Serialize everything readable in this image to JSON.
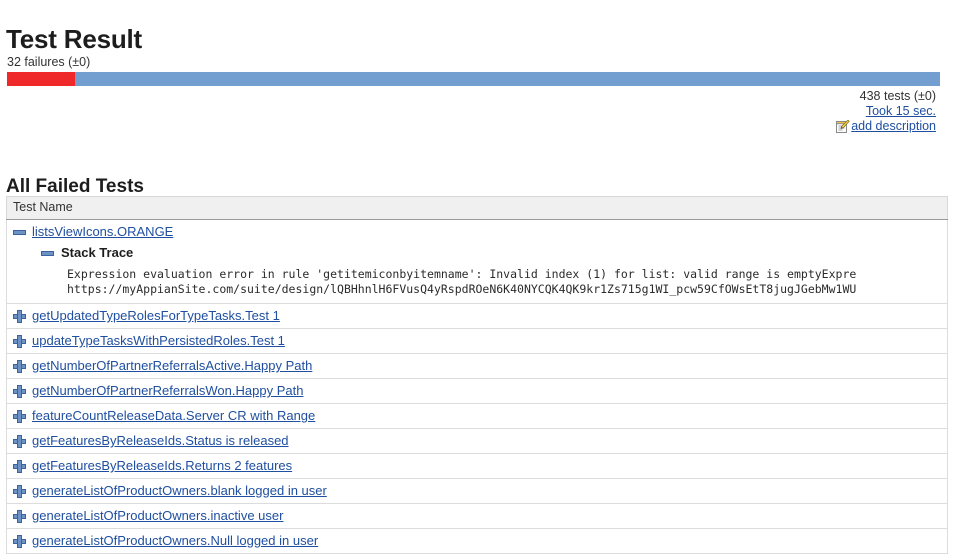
{
  "page": {
    "title": "Test Result",
    "section_title": "All Failed Tests"
  },
  "summary": {
    "failures_label": "32 failures (±0)",
    "failure_count": 32,
    "failure_delta": "±0",
    "tests_label": "438 tests (±0)",
    "tests_total": 438,
    "tests_delta": "±0",
    "duration_label": "Took 15 sec.",
    "add_description_label": "add description",
    "edit_icon": "edit-note-icon",
    "bar": {
      "failed_percent": 7.3,
      "passed_percent": 92.7,
      "failed_color": "#ef2929",
      "passed_color": "#729fcf"
    }
  },
  "table": {
    "header": "Test Name",
    "rows": [
      {
        "name": "listsViewIcons.ORANGE",
        "state": "expanded",
        "icon": "collapse-icon",
        "stack_trace": {
          "label": "Stack Trace",
          "icon": "collapse-icon",
          "lines": [
            "Expression evaluation error in rule 'getitemiconbyitemname': Invalid index (1) for list: valid range is emptyExpre",
            "https://myAppianSite.com/suite/design/lQBHhnlH6FVusQ4yRspdROeN6K40NYCQK4QK9kr1Zs715g1WI_pcw59CfOWsEtT8jugJGebMw1WU"
          ]
        }
      },
      {
        "name": "getUpdatedTypeRolesForTypeTasks.Test 1",
        "state": "collapsed",
        "icon": "expand-icon"
      },
      {
        "name": "updateTypeTasksWithPersistedRoles.Test 1",
        "state": "collapsed",
        "icon": "expand-icon"
      },
      {
        "name": "getNumberOfPartnerReferralsActive.Happy Path",
        "state": "collapsed",
        "icon": "expand-icon"
      },
      {
        "name": "getNumberOfPartnerReferralsWon.Happy Path",
        "state": "collapsed",
        "icon": "expand-icon"
      },
      {
        "name": "featureCountReleaseData.Server CR with Range",
        "state": "collapsed",
        "icon": "expand-icon"
      },
      {
        "name": "getFeaturesByReleaseIds.Status is released",
        "state": "collapsed",
        "icon": "expand-icon"
      },
      {
        "name": "getFeaturesByReleaseIds.Returns 2 features",
        "state": "collapsed",
        "icon": "expand-icon"
      },
      {
        "name": "generateListOfProductOwners.blank logged in user",
        "state": "collapsed",
        "icon": "expand-icon"
      },
      {
        "name": "generateListOfProductOwners.inactive user",
        "state": "collapsed",
        "icon": "expand-icon"
      },
      {
        "name": "generateListOfProductOwners.Null logged in user",
        "state": "collapsed",
        "icon": "expand-icon"
      }
    ]
  }
}
